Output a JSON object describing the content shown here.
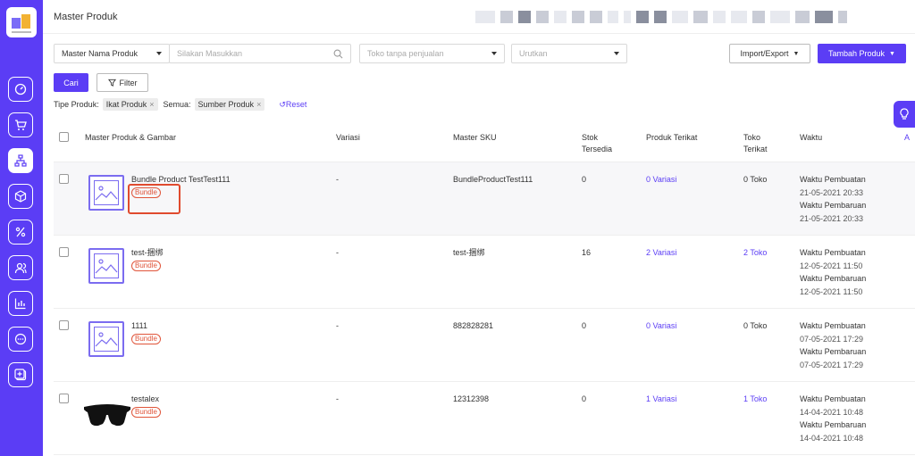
{
  "header": {
    "title": "Master Produk"
  },
  "toolbar": {
    "search_field_select": "Master Nama Produk",
    "search_placeholder": "Silakan Masukkan",
    "store_select_placeholder": "Toko tanpa penjualan",
    "sort_select_placeholder": "Urutkan",
    "import_export_label": "Import/Export",
    "add_product_label": "Tambah Produk",
    "search_button_label": "Cari",
    "filter_button_label": "Filter"
  },
  "active_filters": {
    "type_label": "Tipe Produk:",
    "type_value": "Ikat Produk",
    "all_label": "Semua:",
    "all_value": "Sumber Produk",
    "reset_label": "Reset"
  },
  "table": {
    "columns": [
      "Master Produk & Gambar",
      "Variasi",
      "Master SKU",
      "Stok Tersedia",
      "Produk Terikat",
      "Toko Terikat",
      "Waktu"
    ],
    "rows": [
      {
        "name": "Bundle Product TestTest111",
        "badge": "Bundle",
        "variasi": "-",
        "sku": "BundleProductTest111",
        "stok": "0",
        "produk_terikat": "0 Variasi",
        "toko_terikat": "0 Toko",
        "toko_is_link": false,
        "created_label": "Waktu Pembuatan",
        "created": "21-05-2021 20:33",
        "updated_label": "Waktu Pembaruan",
        "updated": "21-05-2021 20:33",
        "image": "placeholder"
      },
      {
        "name": "test-捆绑",
        "badge": "Bundle",
        "variasi": "-",
        "sku": "test-捆绑",
        "stok": "16",
        "produk_terikat": "2 Variasi",
        "toko_terikat": "2 Toko",
        "toko_is_link": true,
        "created_label": "Waktu Pembuatan",
        "created": "12-05-2021 11:50",
        "updated_label": "Waktu Pembaruan",
        "updated": "12-05-2021 11:50",
        "image": "placeholder"
      },
      {
        "name": "1111",
        "badge": "Bundle",
        "variasi": "-",
        "sku": "882828281",
        "stok": "0",
        "produk_terikat": "0 Variasi",
        "toko_terikat": "0 Toko",
        "toko_is_link": false,
        "created_label": "Waktu Pembuatan",
        "created": "07-05-2021 17:29",
        "updated_label": "Waktu Pembaruan",
        "updated": "07-05-2021 17:29",
        "image": "placeholder"
      },
      {
        "name": "testalex",
        "badge": "Bundle",
        "variasi": "-",
        "sku": "12312398",
        "stok": "0",
        "produk_terikat": "1 Variasi",
        "toko_terikat": "1 Toko",
        "toko_is_link": true,
        "created_label": "Waktu Pembuatan",
        "created": "14-04-2021 10:48",
        "updated_label": "Waktu Pembaruan",
        "updated": "14-04-2021 10:48",
        "image": "sunglasses"
      }
    ]
  },
  "colors": {
    "accent": "#5b3df5",
    "badge": "#e0553a",
    "highlight_box": "#e04a2e"
  },
  "icons": {
    "sidebar": [
      "dashboard-icon",
      "cart-icon",
      "product-tree-icon",
      "box-icon",
      "percent-icon",
      "users-icon",
      "chart-icon",
      "chat-icon",
      "add-square-icon"
    ],
    "search": "search-icon",
    "filter": "filter-icon",
    "reset": "reset-icon",
    "help": "lightbulb-icon"
  }
}
